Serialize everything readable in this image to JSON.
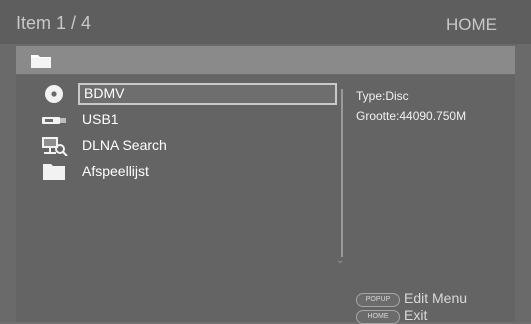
{
  "header": {
    "title": "Item 1 / 4",
    "home_label": "HOME"
  },
  "pathbar": {
    "icon": "folder-icon"
  },
  "list": [
    {
      "label": "BDMV",
      "icon": "disc-icon",
      "selected": true
    },
    {
      "label": "USB1",
      "icon": "usb-icon",
      "selected": false
    },
    {
      "label": "DLNA Search",
      "icon": "dlna-search-icon",
      "selected": false
    },
    {
      "label": "Afspeellijst",
      "icon": "folder-icon",
      "selected": false
    }
  ],
  "info": {
    "type": "Type:Disc",
    "size": "Grootte:44090.750M"
  },
  "footer": {
    "popup_button": "POPUP",
    "popup_text": "Edit Menu",
    "home_button": "HOME",
    "home_text": "Exit"
  },
  "colors": {
    "header_bg": "#5e5e5e",
    "path_bg": "#8a8a8a",
    "content_bg": "#646464",
    "selection_border": "#c9c9c9"
  }
}
